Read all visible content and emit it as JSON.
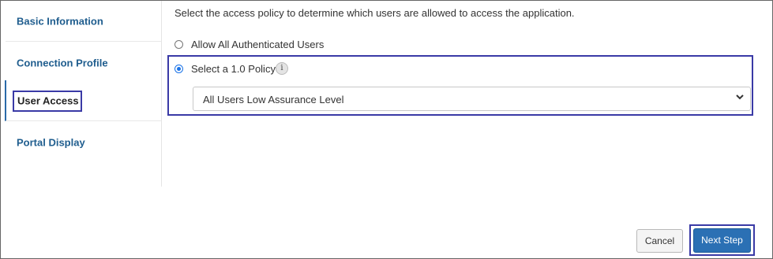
{
  "sidebar": {
    "items": [
      {
        "label": "Basic Information",
        "active": false
      },
      {
        "label": "Connection Profile",
        "active": false
      },
      {
        "label": "User Access",
        "active": true
      },
      {
        "label": "Portal Display",
        "active": false
      }
    ]
  },
  "main": {
    "instructions": "Select the access policy to determine which users are allowed to access the application.",
    "options": [
      {
        "label": "Allow All Authenticated Users",
        "selected": false
      },
      {
        "label": "Select a 1.0 Policy",
        "selected": true
      }
    ],
    "info_icon_glyph": "i",
    "policy_select": {
      "value": "All Users Low Assurance Level"
    }
  },
  "footer": {
    "cancel_label": "Cancel",
    "next_label": "Next Step"
  },
  "colors": {
    "accent": "#2b70b4",
    "nav_text": "#1f5d8e",
    "highlight_border": "#3a3aa6"
  }
}
